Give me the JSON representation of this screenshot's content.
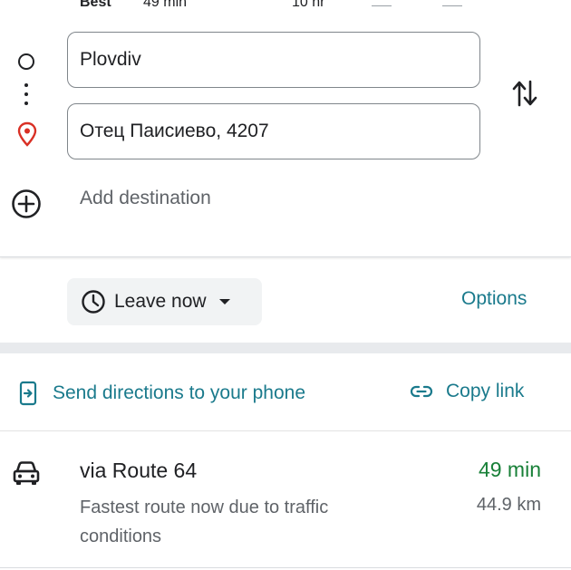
{
  "travel_modes": [
    {
      "label": "Best",
      "time": "49 min"
    },
    {
      "label": "",
      "time": "10 hr"
    },
    {
      "label": "",
      "time": "—"
    },
    {
      "label": "",
      "time": "—"
    }
  ],
  "directions": {
    "origin_value": "Plovdiv",
    "destination_value": "Отец Паисиево, 4207",
    "add_destination_label": "Add destination"
  },
  "departure": {
    "leave_now_label": "Leave now",
    "options_label": "Options"
  },
  "share": {
    "send_to_phone_label": "Send directions to your phone",
    "copy_link_label": "Copy link"
  },
  "routes": [
    {
      "title": "via Route 64",
      "description": "Fastest route now due to traffic conditions",
      "duration": "49 min",
      "distance": "44.9 km"
    }
  ],
  "colors": {
    "accent": "#1a7a8c",
    "duration_green": "#188038",
    "destination_pin": "#d93025"
  },
  "icons": {
    "origin": "origin-circle-icon",
    "destination": "location-pin-icon",
    "swap": "swap-vertical-icon",
    "add": "add-circle-icon",
    "clock": "clock-icon",
    "caret": "caret-down-icon",
    "phone": "send-to-phone-icon",
    "link": "link-icon",
    "car": "car-icon"
  }
}
